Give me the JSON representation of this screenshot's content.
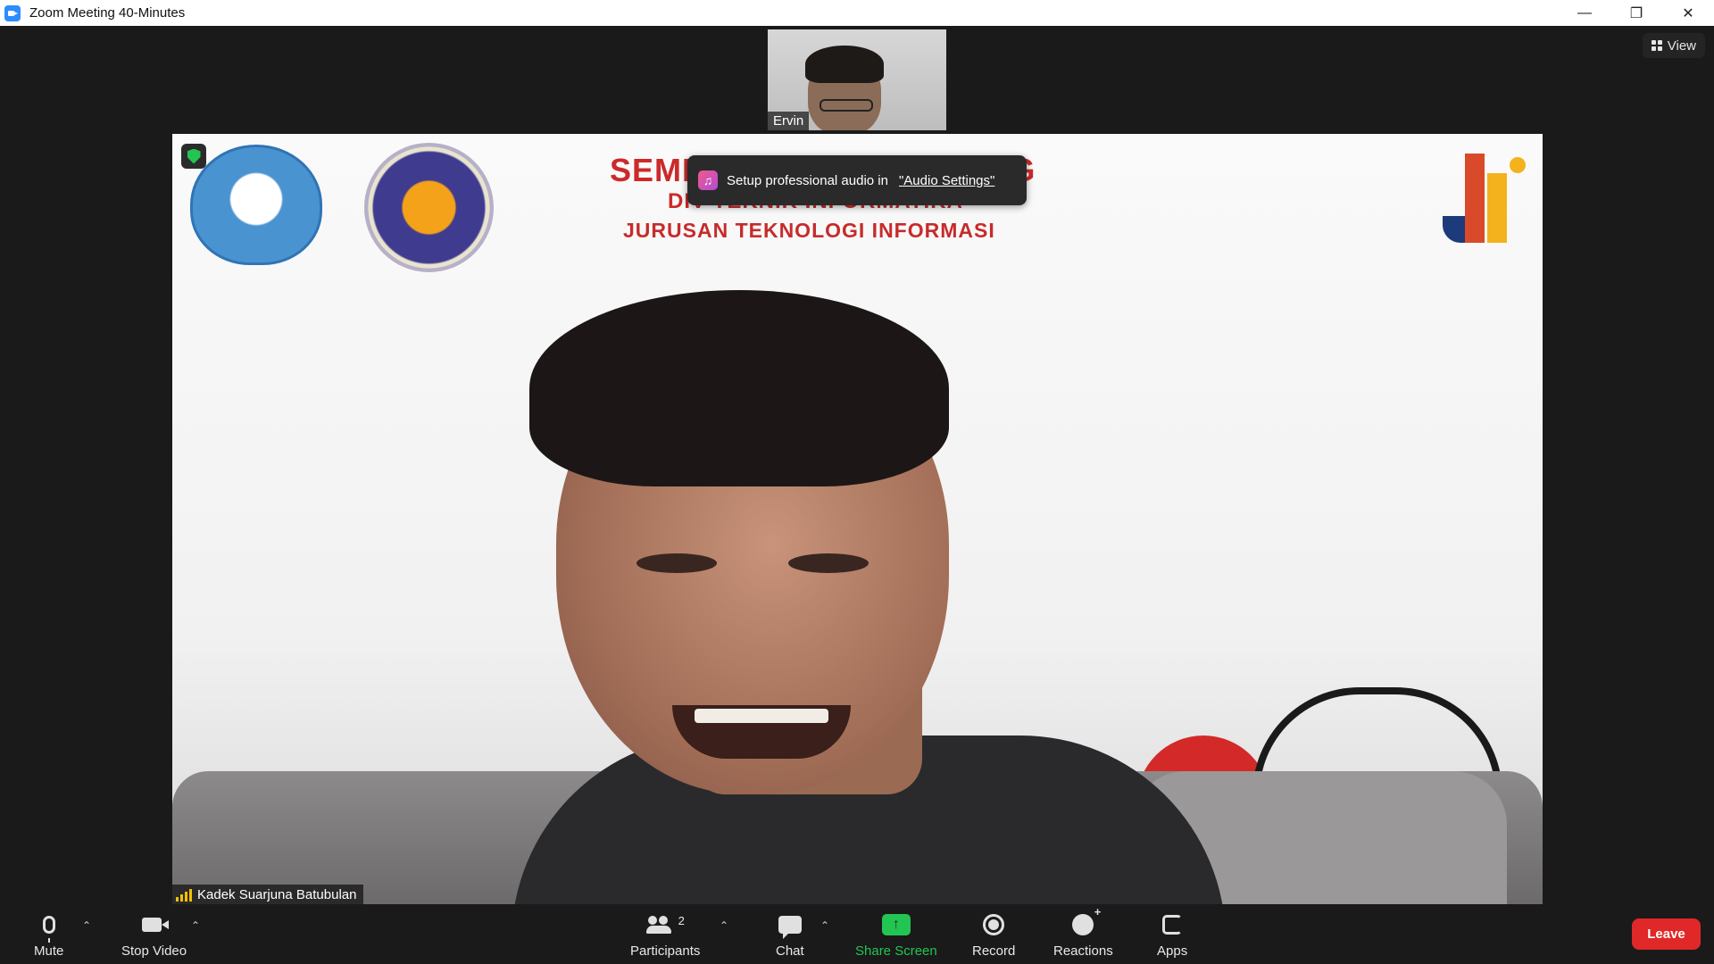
{
  "window": {
    "title": "Zoom Meeting 40-Minutes"
  },
  "view_button": {
    "label": "View"
  },
  "thumbnail": {
    "name": "Ervin"
  },
  "main_video": {
    "participant_name": "Kadek Suarjuna Batubulan",
    "slide": {
      "title": "SEMINAR HASIL MAGANG",
      "line1": "DIV TEKNIK INFORMATIKA",
      "line2": "JURUSAN TEKNOLOGI INFORMASI"
    }
  },
  "toast": {
    "text": "Setup professional audio in",
    "link": "\"Audio Settings\""
  },
  "toolbar": {
    "mute_label": "Mute",
    "stop_video_label": "Stop Video",
    "participants_label": "Participants",
    "participants_count": "2",
    "chat_label": "Chat",
    "share_screen_label": "Share Screen",
    "record_label": "Record",
    "reactions_label": "Reactions",
    "apps_label": "Apps",
    "leave_label": "Leave"
  },
  "colors": {
    "share_green": "#23c552",
    "leave_red": "#e02828",
    "slide_red": "#cc2a2a"
  }
}
